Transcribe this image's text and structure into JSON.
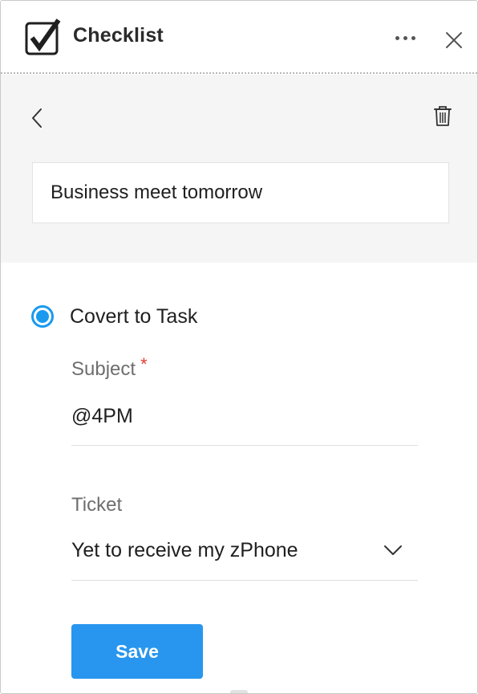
{
  "header": {
    "title": "Checklist",
    "icons": {
      "logo": "checkbox-check-icon",
      "more": "more-horizontal-icon",
      "close": "close-icon"
    }
  },
  "toolbar": {
    "icons": {
      "back": "chevron-left-icon",
      "delete": "trash-icon"
    }
  },
  "checklist_item": {
    "text": "Business meet tomorrow"
  },
  "convert": {
    "option_label": "Covert to Task",
    "selected": true,
    "subject": {
      "label": "Subject",
      "required_marker": "*",
      "value": "@4PM"
    },
    "ticket": {
      "label": "Ticket",
      "value": "Yet to receive my zPhone",
      "icon": "chevron-down-icon"
    },
    "save_label": "Save"
  },
  "colors": {
    "accent": "#2896ee",
    "radio": "#1a9aef",
    "required": "#e53935",
    "panel_gray": "#f5f5f5"
  }
}
